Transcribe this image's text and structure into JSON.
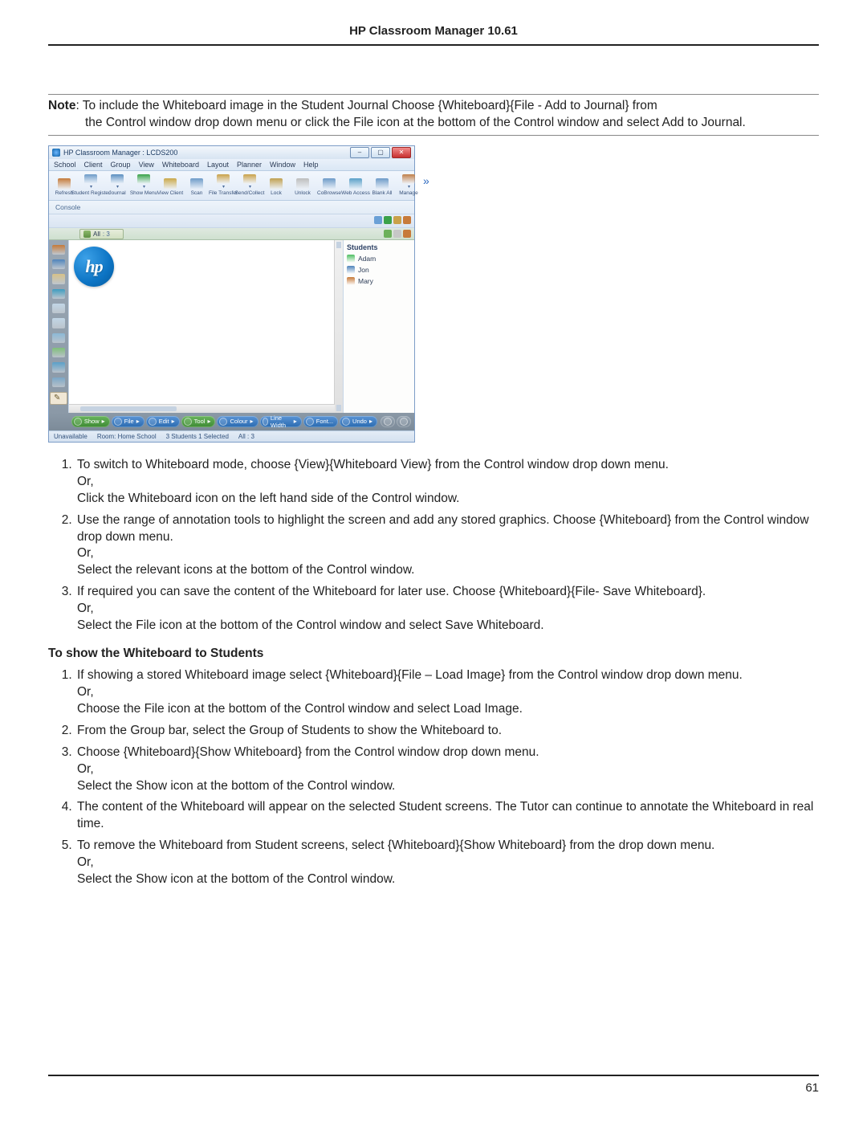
{
  "doc": {
    "header_title": "HP Classroom Manager 10.61",
    "page_number": "61",
    "note_label": "Note",
    "note_text_line1": ": To include the Whiteboard image in the Student Journal Choose {Whiteboard}{File - Add to Journal} from",
    "note_text_line2": "the Control window drop down menu or click the File icon at the bottom of the Control window and select Add to Journal.",
    "section_show_title": "To show the Whiteboard to Students",
    "steps_a": {
      "s1a": "To switch to Whiteboard mode, choose {View}{Whiteboard View} from the Control window drop down menu.",
      "s1b": "Or,",
      "s1c": "Click the Whiteboard icon on the left hand side of the Control window.",
      "s2a": "Use the range of annotation tools to highlight the screen and add any stored graphics. Choose {Whiteboard} from the Control window drop down menu.",
      "s2b": "Or,",
      "s2c": "Select the relevant icons at the bottom of the Control window.",
      "s3a": "If required you can save the content of the Whiteboard for later use. Choose {Whiteboard}{File- Save Whiteboard}.",
      "s3b": "Or,",
      "s3c": "Select the File icon at the bottom of the Control window and select Save Whiteboard."
    },
    "steps_b": {
      "s1a": "If showing a stored Whiteboard image select {Whiteboard}{File – Load Image} from the Control window drop down menu.",
      "s1b": "Or,",
      "s1c": "Choose the File icon at the bottom of the Control window and select Load Image.",
      "s2a": "From the Group bar, select the Group of Students to show the Whiteboard to.",
      "s3a": "Choose {Whiteboard}{Show Whiteboard} from the Control window drop down menu.",
      "s3b": "Or,",
      "s3c": "Select the Show icon at the bottom of the Control window.",
      "s4a": "The content of the Whiteboard will appear on the selected Student screens. The Tutor can continue to annotate the Whiteboard in real time.",
      "s5a": "To remove the Whiteboard from Student screens, select {Whiteboard}{Show Whiteboard} from the drop down menu.",
      "s5b": "Or,",
      "s5c": "Select the Show icon at the bottom of the Control window."
    }
  },
  "app": {
    "window_title": "HP Classroom Manager : LCDS200",
    "menus": [
      "School",
      "Client",
      "Group",
      "View",
      "Whiteboard",
      "Layout",
      "Planner",
      "Window",
      "Help"
    ],
    "toolbar": [
      {
        "id": "refresh",
        "label": "Refresh",
        "color": "#c47a3a"
      },
      {
        "id": "student-register",
        "label": "Student Register",
        "color": "#6d9bc8"
      },
      {
        "id": "journal",
        "label": "Journal",
        "color": "#5b8fc0"
      },
      {
        "id": "show-menu",
        "label": "Show Menu",
        "color": "#3aa24a"
      },
      {
        "id": "view-client",
        "label": "View Client",
        "color": "#caa84a"
      },
      {
        "id": "scan",
        "label": "Scan",
        "color": "#6d9bc8"
      },
      {
        "id": "file-transfer",
        "label": "File Transfer",
        "color": "#c9a14a"
      },
      {
        "id": "send-collect",
        "label": "Send/Collect",
        "color": "#c9a14a"
      },
      {
        "id": "lock",
        "label": "Lock",
        "color": "#c0a050"
      },
      {
        "id": "unlock",
        "label": "Unlock",
        "color": "#bdbdbd"
      },
      {
        "id": "coview",
        "label": "CoBrowse",
        "color": "#6d9bc8"
      },
      {
        "id": "web-access",
        "label": "Web Access",
        "color": "#5aa0c8"
      },
      {
        "id": "blank-all",
        "label": "Blank All",
        "color": "#6d9bc8"
      },
      {
        "id": "manage",
        "label": "Manage",
        "color": "#c07f4a"
      }
    ],
    "subbar_label": "Console",
    "group_tab_label": "All",
    "group_tab_count": ": 3",
    "side_icons": [
      {
        "id": "classes-icon",
        "color": "#c47a3a"
      },
      {
        "id": "whiteboard-icon",
        "color": "#4f84bb"
      },
      {
        "id": "chat-icon",
        "color": "#d6c188"
      },
      {
        "id": "web-icon",
        "color": "#3e9cc0"
      },
      {
        "id": "apps-icon",
        "color": "#c1d6e6"
      },
      {
        "id": "devices-icon",
        "color": "#c1d6e6"
      },
      {
        "id": "survey-icon",
        "color": "#8bb8d6"
      },
      {
        "id": "testing-icon",
        "color": "#7fbf7a"
      },
      {
        "id": "questions-icon",
        "color": "#5aa0c8"
      },
      {
        "id": "rewards-icon",
        "color": "#7aa7c7"
      }
    ],
    "hp_logo_text": "hp",
    "students_header": "Students",
    "students": [
      {
        "name": "Adam",
        "color": "#4fbf63"
      },
      {
        "name": "Jon",
        "color": "#4f84bb"
      },
      {
        "name": "Mary",
        "color": "#c77a3a"
      }
    ],
    "bottom_tools": [
      {
        "id": "show",
        "label": "Show",
        "bg": "green"
      },
      {
        "id": "file",
        "label": "File",
        "bg": "blue"
      },
      {
        "id": "edit",
        "label": "Edit",
        "bg": "blue"
      },
      {
        "id": "tool",
        "label": "Tool",
        "bg": "green"
      },
      {
        "id": "colour",
        "label": "Colour",
        "bg": "blue"
      },
      {
        "id": "line-width",
        "label": "Line Width",
        "bg": "blue"
      },
      {
        "id": "font",
        "label": "Font...",
        "bg": "blue"
      },
      {
        "id": "undo",
        "label": "Undo",
        "bg": "blue"
      }
    ],
    "status_items": [
      "Unavailable",
      "Room: Home School",
      "3 Students  1 Selected",
      "All : 3"
    ]
  }
}
